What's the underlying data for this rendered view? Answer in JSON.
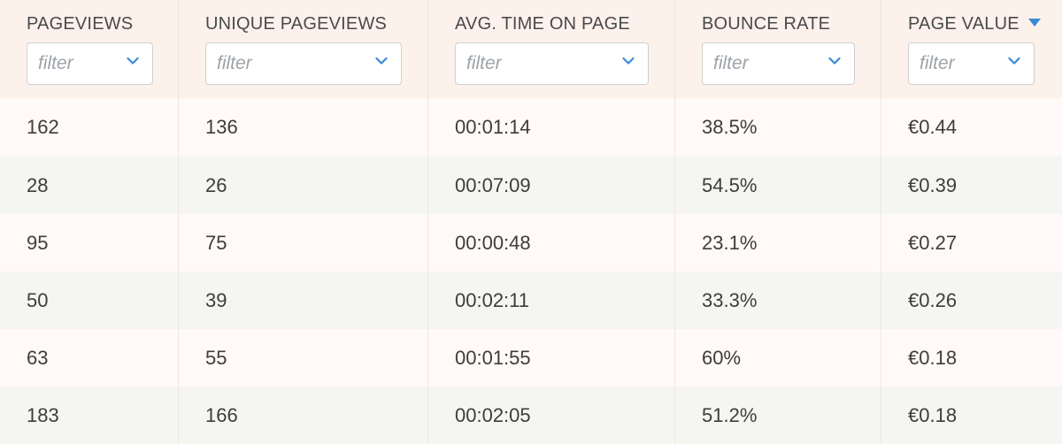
{
  "table": {
    "columns": [
      {
        "title": "PAGEVIEWS",
        "filter_placeholder": "filter",
        "sorted": false
      },
      {
        "title": "UNIQUE PAGEVIEWS",
        "filter_placeholder": "filter",
        "sorted": false
      },
      {
        "title": "AVG. TIME ON PAGE",
        "filter_placeholder": "filter",
        "sorted": false
      },
      {
        "title": "BOUNCE RATE",
        "filter_placeholder": "filter",
        "sorted": false
      },
      {
        "title": "PAGE VALUE",
        "filter_placeholder": "filter",
        "sorted": true,
        "sort_direction": "descending"
      }
    ],
    "rows": [
      [
        "162",
        "136",
        "00:01:14",
        "38.5%",
        "€0.44"
      ],
      [
        "28",
        "26",
        "00:07:09",
        "54.5%",
        "€0.39"
      ],
      [
        "95",
        "75",
        "00:00:48",
        "23.1%",
        "€0.27"
      ],
      [
        "50",
        "39",
        "00:02:11",
        "33.3%",
        "€0.26"
      ],
      [
        "63",
        "55",
        "00:01:55",
        "60%",
        "€0.18"
      ],
      [
        "183",
        "166",
        "00:02:05",
        "51.2%",
        "€0.18"
      ]
    ]
  },
  "colors": {
    "header_bg": "#fdf1ec",
    "row_odd_bg": "#fffaf7",
    "row_even_bg": "#f5f5f2",
    "accent": "#3a8ad6",
    "placeholder": "#9ea3a8"
  },
  "icons": {
    "filter_dropdown": "chevron-down-icon",
    "sort": "sort-descending-icon"
  }
}
